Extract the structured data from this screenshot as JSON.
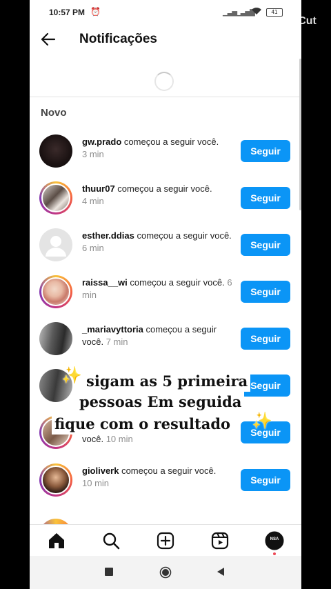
{
  "status": {
    "time": "10:57 PM",
    "battery": "41"
  },
  "watermark": "CapCut",
  "header": {
    "title": "Notificações"
  },
  "section_label": "Novo",
  "follow_label": "Seguir",
  "notifications": [
    {
      "username": "gw.prado",
      "text": " começou a seguir você.",
      "time": "3 min"
    },
    {
      "username": "thuur07",
      "text": " começou a seguir você.",
      "time": "4 min"
    },
    {
      "username": "esther.ddias",
      "text": " começou a seguir você.",
      "time": "6 min"
    },
    {
      "username": "raissa__wi",
      "text": " começou a seguir você.",
      "time": "6 min"
    },
    {
      "username": "_mariavyttoria",
      "text": " começou a seguir você.",
      "time": "7 min"
    },
    {
      "username": "",
      "text": "",
      "time": ""
    },
    {
      "username": "",
      "text": "você.",
      "time": "10 min"
    },
    {
      "username": "gioliverk",
      "text": " começou a seguir você.",
      "time": "10 min"
    }
  ],
  "overlay": {
    "line1": "sigam as 5 primeira",
    "line2": "pessoas Em seguida",
    "line3": "fique com o resultado",
    "sparkle": "✨"
  },
  "nav": {
    "profile_initials": "NSA"
  },
  "colors": {
    "follow": "#0b95f6",
    "story_ring": "#c13584",
    "bg": "#ffffff"
  }
}
